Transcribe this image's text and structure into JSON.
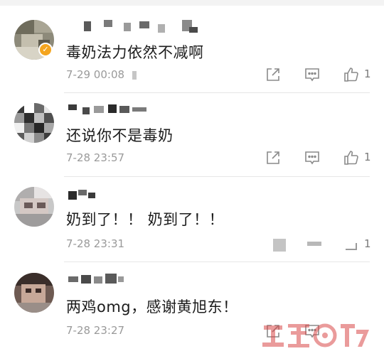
{
  "colors": {
    "background": "#ffffff",
    "text": "#1c1c1c",
    "meta": "#9a9a9a",
    "icon": "#8a8a8a",
    "verified_badge": "#f4a51f"
  },
  "comments": [
    {
      "text": "毒奶法力依然不减啊",
      "time": "7-29 00:08",
      "likes": "1",
      "verified": true,
      "icons": [
        "share-icon",
        "reply-icon",
        "like-icon"
      ]
    },
    {
      "text": "还说你不是毒奶",
      "time": "7-28 23:57",
      "likes": "1",
      "verified": false,
      "icons": [
        "share-icon",
        "reply-icon",
        "like-icon"
      ]
    },
    {
      "text": "奶到了！！ 奶到了！！",
      "time": "7-28 23:31",
      "likes": "1",
      "verified": false,
      "icons": []
    },
    {
      "text": "两鸡omg，感谢黄旭东！",
      "time": "7-28 23:27",
      "likes": "",
      "verified": false,
      "icons": [
        "share-icon",
        "reply-icon"
      ]
    }
  ],
  "badge_symbol": "✓"
}
